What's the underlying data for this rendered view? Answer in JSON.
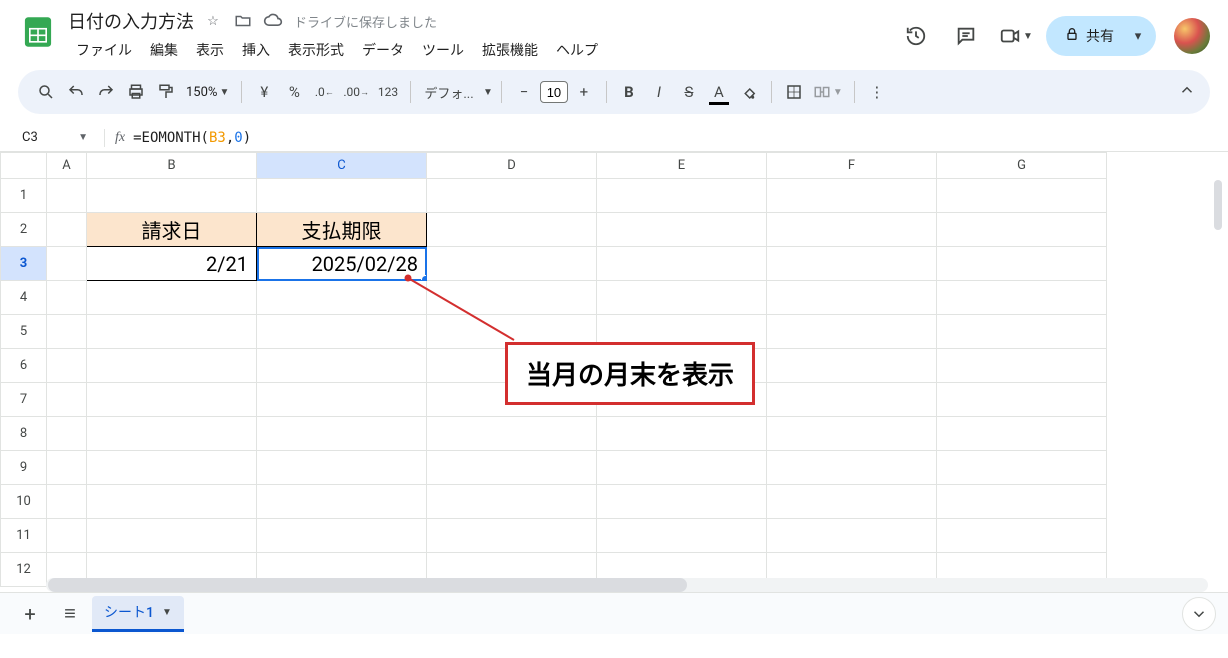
{
  "doc": {
    "title": "日付の入力方法",
    "save_msg": "ドライブに保存しました"
  },
  "menus": [
    "ファイル",
    "編集",
    "表示",
    "挿入",
    "表示形式",
    "データ",
    "ツール",
    "拡張機能",
    "ヘルプ"
  ],
  "share_label": "共有",
  "toolbar": {
    "zoom": "150%",
    "font": "デフォ...",
    "font_size": "10"
  },
  "name_box": "C3",
  "formula": {
    "prefix": "=EOMONTH(",
    "ref": "B3",
    "comma": ",",
    "num": "0",
    "suffix": ")"
  },
  "columns": [
    "A",
    "B",
    "C",
    "D",
    "E",
    "F",
    "G"
  ],
  "rows": [
    "1",
    "2",
    "3",
    "4",
    "5",
    "6",
    "7",
    "8",
    "9",
    "10",
    "11",
    "12"
  ],
  "cells": {
    "B2": "請求日",
    "C2": "支払期限",
    "B3": "2/21",
    "C3": "2025/02/28"
  },
  "annotation": "当月の月末を表示",
  "sheet_tab": "シート1"
}
